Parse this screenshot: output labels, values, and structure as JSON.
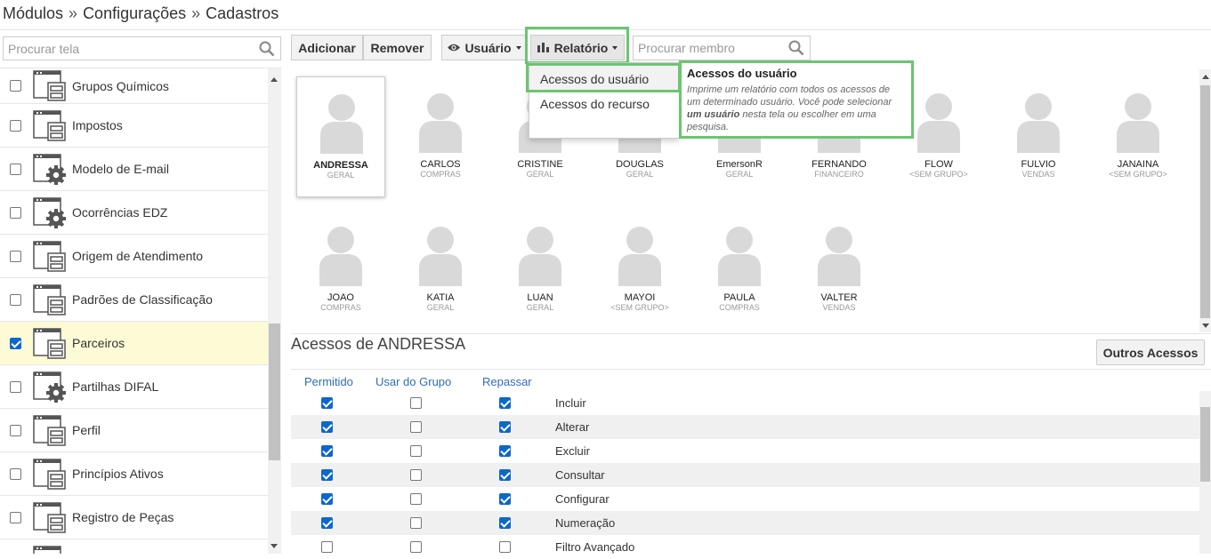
{
  "breadcrumb": [
    "Módulos",
    "Configurações",
    "Cadastros"
  ],
  "breadcrumb_sep": "»",
  "sidebar": {
    "search_placeholder": "Procurar tela",
    "items": [
      {
        "label": "Grupos Químicos",
        "icon": "form-icon",
        "checked": false
      },
      {
        "label": "Impostos",
        "icon": "form-icon",
        "checked": false
      },
      {
        "label": "Modelo de E-mail",
        "icon": "gear-window-icon",
        "checked": false
      },
      {
        "label": "Ocorrências EDZ",
        "icon": "gear-window-icon",
        "checked": false
      },
      {
        "label": "Origem de Atendimento",
        "icon": "form-icon",
        "checked": false
      },
      {
        "label": "Padrões de Classificação",
        "icon": "form-icon",
        "checked": false
      },
      {
        "label": "Parceiros",
        "icon": "form-icon",
        "checked": true
      },
      {
        "label": "Partilhas DIFAL",
        "icon": "gear-window-icon",
        "checked": false
      },
      {
        "label": "Perfil",
        "icon": "form-icon",
        "checked": false
      },
      {
        "label": "Princípios Ativos",
        "icon": "form-icon",
        "checked": false
      },
      {
        "label": "Registro de Peças",
        "icon": "form-icon",
        "checked": false
      }
    ]
  },
  "toolbar": {
    "add_label": "Adicionar",
    "remove_label": "Remover",
    "user_label": "Usuário",
    "report_label": "Relatório",
    "member_placeholder": "Procurar membro"
  },
  "report_menu": {
    "items": [
      "Acessos do usuário",
      "Acessos do recurso"
    ]
  },
  "tooltip": {
    "title": "Acessos do usuário",
    "body_1": "Imprime um relatório com todos os acessos de um determinado usuário. Você pode selecionar ",
    "body_bold": "um usuário",
    "body_2": " nesta tela ou escolher em uma pesquisa."
  },
  "users": [
    {
      "name": "ANDRESSA",
      "group": "GERAL",
      "selected": true
    },
    {
      "name": "CARLOS",
      "group": "COMPRAS"
    },
    {
      "name": "CRISTINE",
      "group": "GERAL"
    },
    {
      "name": "DOUGLAS",
      "group": "GERAL"
    },
    {
      "name": "EmersonR",
      "group": "GERAL"
    },
    {
      "name": "FERNANDO",
      "group": "FINANCEIRO"
    },
    {
      "name": "FLOW",
      "group": "<SEM GRUPO>"
    },
    {
      "name": "FULVIO",
      "group": "VENDAS"
    },
    {
      "name": "JANAINA",
      "group": "<SEM GRUPO>"
    },
    {
      "name": "JOAO",
      "group": "COMPRAS"
    },
    {
      "name": "KATIA",
      "group": "GERAL"
    },
    {
      "name": "LUAN",
      "group": "GERAL"
    },
    {
      "name": "MAYOI",
      "group": "<SEM GRUPO>"
    },
    {
      "name": "PAULA",
      "group": "COMPRAS"
    },
    {
      "name": "VALTER",
      "group": "VENDAS"
    }
  ],
  "access": {
    "title": "Acessos de ANDRESSA",
    "other_button": "Outros Acessos",
    "columns": [
      "Permitido",
      "Usar do Grupo",
      "Repassar"
    ],
    "rows": [
      {
        "label": "Incluir",
        "permitido": true,
        "grupo": false,
        "repassar": true
      },
      {
        "label": "Alterar",
        "permitido": true,
        "grupo": false,
        "repassar": true
      },
      {
        "label": "Excluir",
        "permitido": true,
        "grupo": false,
        "repassar": true
      },
      {
        "label": "Consultar",
        "permitido": true,
        "grupo": false,
        "repassar": true
      },
      {
        "label": "Configurar",
        "permitido": true,
        "grupo": false,
        "repassar": true
      },
      {
        "label": "Numeração",
        "permitido": true,
        "grupo": false,
        "repassar": true
      },
      {
        "label": "Filtro Avançado",
        "permitido": false,
        "grupo": false,
        "repassar": false
      }
    ]
  },
  "colors": {
    "accent_blue": "#2f6db5",
    "highlight_green": "#6cc570",
    "selected_row": "#fdfbd5",
    "checkbox_blue": "#0b67d0"
  }
}
